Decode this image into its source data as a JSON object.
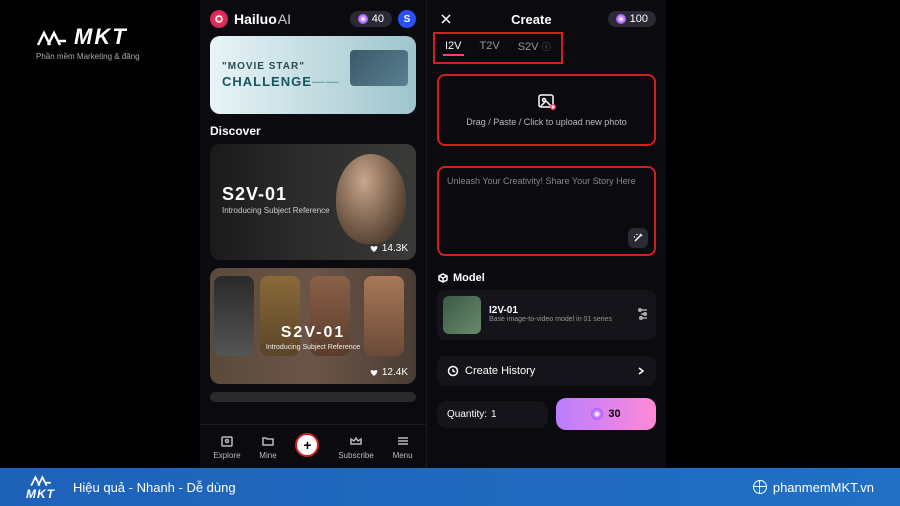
{
  "mkt_brand": "MKT",
  "mkt_sub": "Phần mềm Marketing & đăng",
  "app": {
    "name": "Hailuo",
    "suffix": "AI"
  },
  "header_credits_left": "40",
  "header_credits_right": "100",
  "avatar_letter": "S",
  "banner": {
    "line1": "\"MOVIE STAR\"",
    "line2": "CHALLENGE",
    "dash": "——"
  },
  "discover_label": "Discover",
  "cards": [
    {
      "title": "S2V-01",
      "sub": "Introducing Subject Reference",
      "likes": "14.3K"
    },
    {
      "title": "S2V-01",
      "sub": "Introducing Subject Reference",
      "likes": "12.4K"
    }
  ],
  "nav": {
    "explore": "Explore",
    "mine": "Mine",
    "subscribe": "Subscribe",
    "menu": "Menu"
  },
  "create_title": "Create",
  "tabs": {
    "i2v": "I2V",
    "t2v": "T2V",
    "s2v": "S2V"
  },
  "upload_text": "Drag / Paste / Click to upload new photo",
  "prompt_placeholder": "Unleash Your Creativity! Share Your Story Here",
  "model_label": "Model",
  "model": {
    "name": "I2V-01",
    "desc": "Base image-to-video model in 01 series"
  },
  "history_label": "Create History",
  "quantity_label": "Quantity:",
  "quantity_value": "1",
  "go_cost": "30",
  "footer": {
    "slogan": "Hiệu quả - Nhanh - Dễ dùng",
    "url": "phanmemMKT.vn"
  }
}
